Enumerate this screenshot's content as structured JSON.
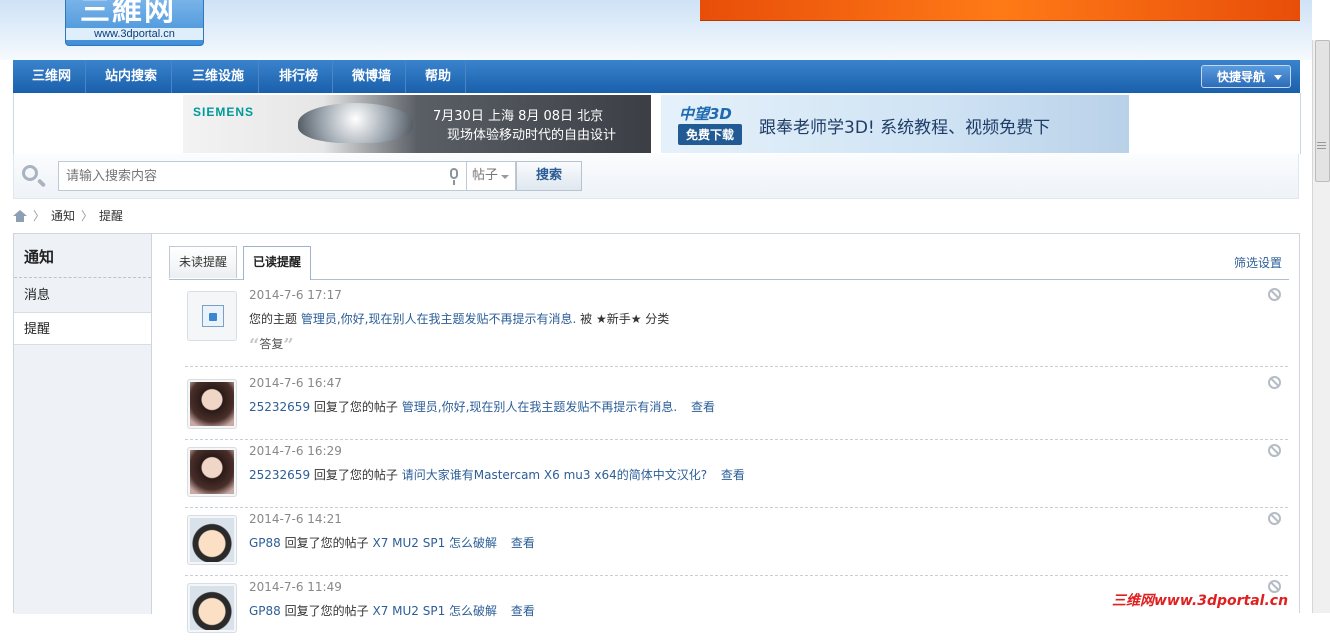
{
  "header": {
    "logo_text": "三維网",
    "logo_url": "www.3dportal.cn"
  },
  "nav": {
    "items": [
      "三维网",
      "站内搜索",
      "三维设施",
      "排行榜",
      "微博墙",
      "帮助"
    ],
    "quick_nav": "快捷导航"
  },
  "ads": {
    "left": {
      "brand": "SIEMENS",
      "line1": "7月30日 上海    8月 08日 北京",
      "line2": "现场体验移动时代的自由设计"
    },
    "right": {
      "brand": "中望3D",
      "download": "免费下载",
      "slogan": "跟奉老师学3D! 系统教程、视频免费下"
    }
  },
  "search": {
    "placeholder": "请输入搜索内容",
    "type": "帖子",
    "button": "搜索"
  },
  "breadcrumb": {
    "items": [
      "通知",
      "提醒"
    ]
  },
  "sidebar": {
    "title": "通知",
    "items": [
      "消息",
      "提醒"
    ]
  },
  "tabs": {
    "unread": "未读提醒",
    "read": "已读提醒",
    "filter": "筛选设置"
  },
  "notices": [
    {
      "time": "2014-7-6 17:17",
      "prefix": "您的主题",
      "link": "管理员,你好,现在别人在我主题发贴不再提示有消息.",
      "suffix": "被 ★新手★ 分类",
      "reply": "答复"
    },
    {
      "time": "2014-7-6 16:47",
      "user": "25232659",
      "action": "回复了您的帖子",
      "link": "管理员,你好,现在别人在我主题发贴不再提示有消息.",
      "view": "查看"
    },
    {
      "time": "2014-7-6 16:29",
      "user": "25232659",
      "action": "回复了您的帖子",
      "link": "请问大家谁有Mastercam X6 mu3 x64的简体中文汉化?",
      "view": "查看"
    },
    {
      "time": "2014-7-6 14:21",
      "user": "GP88",
      "action": "回复了您的帖子",
      "link": "X7 MU2 SP1 怎么破解",
      "view": "查看"
    },
    {
      "time": "2014-7-6 11:49",
      "user": "GP88",
      "action": "回复了您的帖子",
      "link": "X7 MU2 SP1 怎么破解",
      "view": "查看"
    }
  ],
  "watermark": "三维网www.3dportal.cn"
}
